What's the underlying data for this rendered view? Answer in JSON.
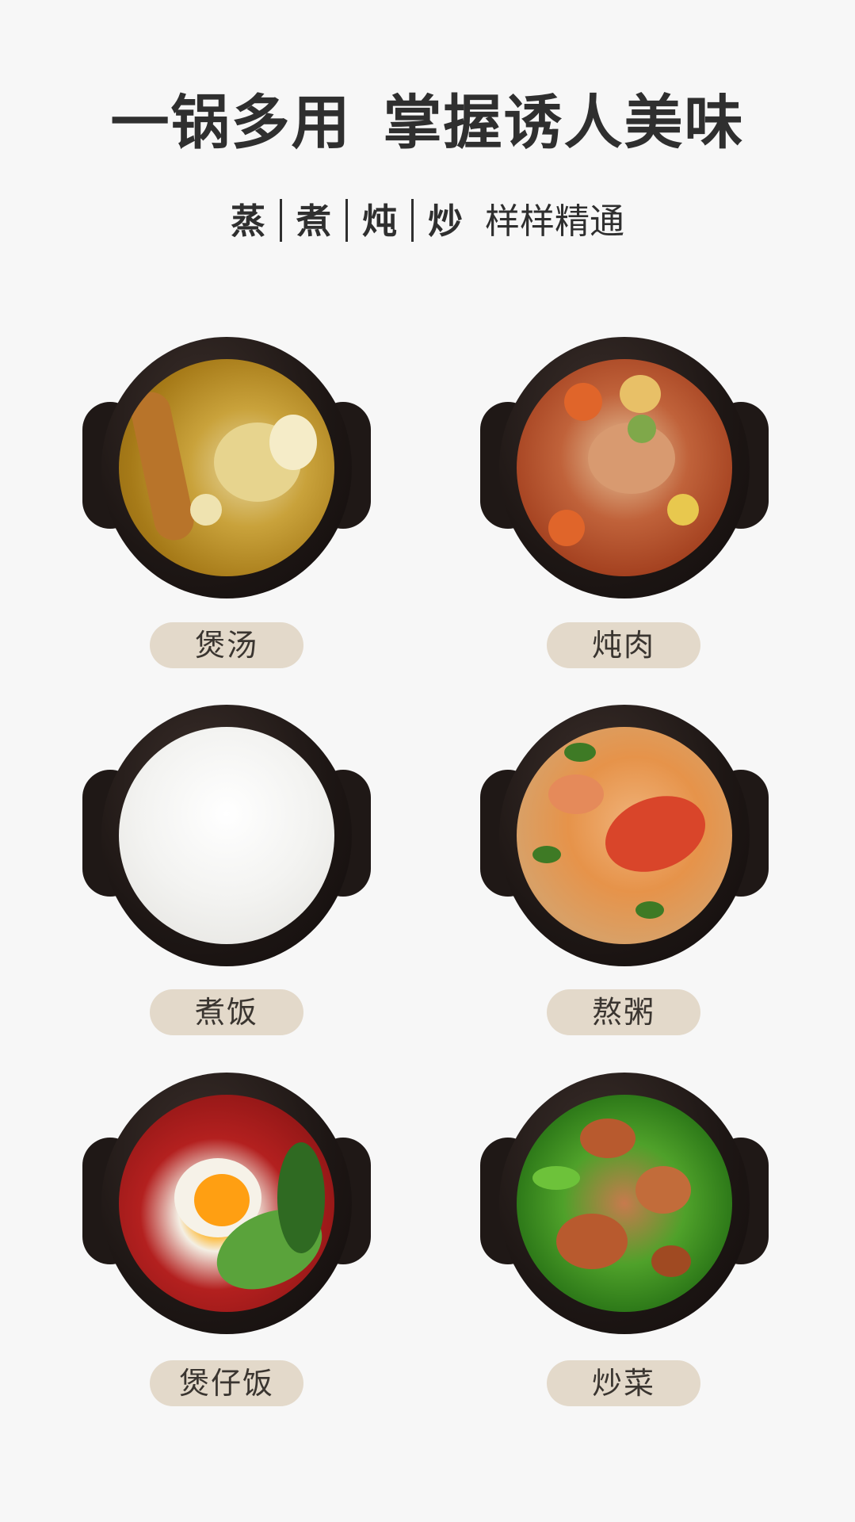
{
  "header": {
    "title_part1": "一锅多用",
    "title_part2": "掌握诱人美味",
    "methods": [
      "蒸",
      "煮",
      "炖",
      "炒"
    ],
    "methods_tail": "样样精通"
  },
  "dishes": [
    {
      "label": "煲汤",
      "icon": "soup-pot-image"
    },
    {
      "label": "炖肉",
      "icon": "stew-pot-image"
    },
    {
      "label": "煮饭",
      "icon": "rice-pot-image"
    },
    {
      "label": "熬粥",
      "icon": "porridge-pot-image"
    },
    {
      "label": "煲仔饭",
      "icon": "claypot-rice-image"
    },
    {
      "label": "炒菜",
      "icon": "stir-fry-pot-image"
    }
  ],
  "colors": {
    "background": "#f7f7f7",
    "text": "#2f2f2f",
    "label_bg": "#e3d9ca",
    "pot": "#1d1614"
  }
}
